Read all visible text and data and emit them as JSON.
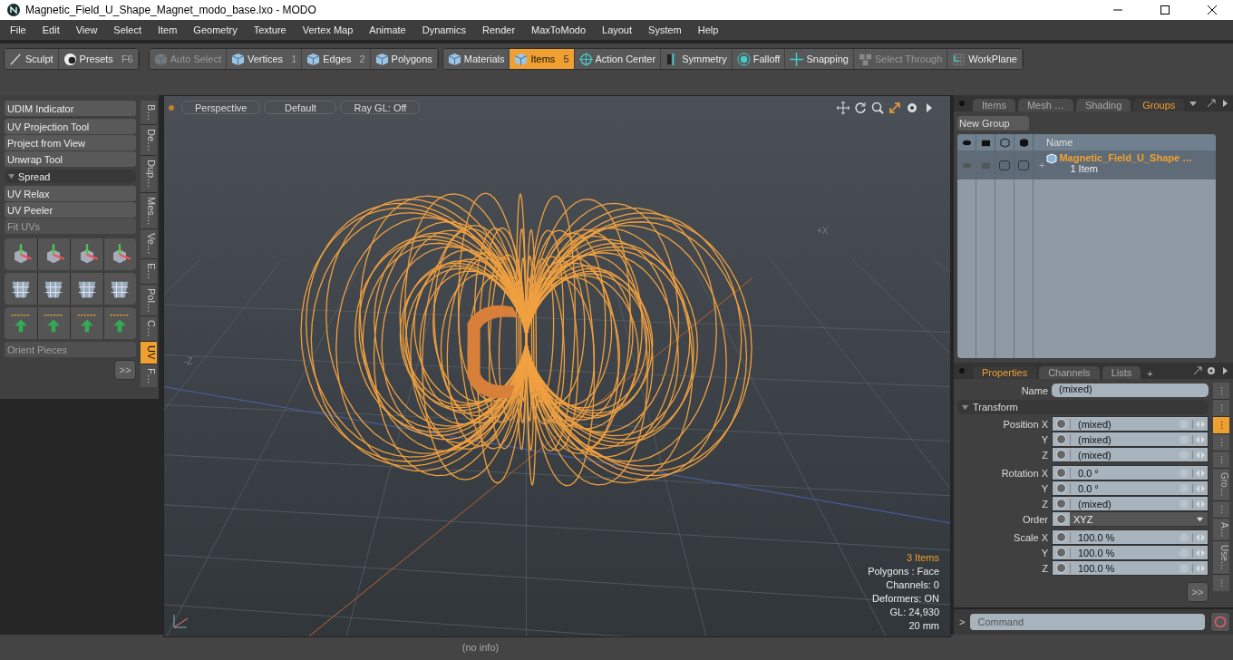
{
  "window": {
    "title": "Magnetic_Field_U_Shape_Magnet_modo_base.lxo - MODO"
  },
  "menu": [
    "File",
    "Edit",
    "View",
    "Select",
    "Item",
    "Geometry",
    "Texture",
    "Vertex Map",
    "Animate",
    "Dynamics",
    "Render",
    "MaxToModo",
    "Layout",
    "System",
    "Help"
  ],
  "toolbar": [
    [
      {
        "label": "Sculpt",
        "disabled": false,
        "selected": false
      },
      {
        "label": "Presets",
        "shortcut": "F6",
        "disabled": false,
        "selected": false
      }
    ],
    [
      {
        "label": "Auto Select",
        "disabled": true,
        "selected": false
      },
      {
        "label": "Vertices",
        "shortcut": "1",
        "disabled": false,
        "selected": false
      },
      {
        "label": "Edges",
        "shortcut": "2",
        "disabled": false,
        "selected": false
      },
      {
        "label": "Polygons",
        "disabled": false,
        "selected": false
      }
    ],
    [
      {
        "label": "Materials",
        "disabled": false,
        "selected": false
      },
      {
        "label": "Items",
        "shortcut": "5",
        "disabled": false,
        "selected": true
      },
      {
        "label": "Action Center",
        "disabled": false,
        "selected": false
      },
      {
        "label": "Symmetry",
        "disabled": false,
        "selected": false
      },
      {
        "label": "Falloff",
        "disabled": false,
        "selected": false
      },
      {
        "label": "Snapping",
        "disabled": false,
        "selected": false
      },
      {
        "label": "Select Through",
        "disabled": true,
        "selected": false
      },
      {
        "label": "WorkPlane",
        "disabled": false,
        "selected": false
      }
    ]
  ],
  "left_panel": {
    "tool_groups": [
      {
        "kind": "buttons",
        "items": [
          {
            "label": "UDIM Indicator",
            "disabled": false
          }
        ]
      },
      {
        "kind": "buttons",
        "items": [
          {
            "label": "UV Projection Tool",
            "disabled": false
          },
          {
            "label": "Project from View",
            "disabled": false
          },
          {
            "label": "Unwrap Tool",
            "disabled": false
          }
        ]
      },
      {
        "kind": "section",
        "label": "Spread",
        "expanded": true
      },
      {
        "kind": "buttons",
        "items": [
          {
            "label": "UV Relax",
            "disabled": false
          },
          {
            "label": "UV Peeler",
            "disabled": false
          },
          {
            "label": "Fit UVs",
            "disabled": true
          }
        ]
      },
      {
        "kind": "icons"
      },
      {
        "kind": "buttons",
        "items": [
          {
            "label": "Orient Pieces",
            "disabled": true
          }
        ]
      }
    ],
    "more": ">>",
    "tabs": [
      {
        "label": "B…",
        "selected": false
      },
      {
        "label": "De…",
        "selected": false
      },
      {
        "label": "Dup…",
        "selected": false
      },
      {
        "label": "Mes…",
        "selected": false
      },
      {
        "label": "Ve…",
        "selected": false
      },
      {
        "label": "E…",
        "selected": false
      },
      {
        "label": "Pol…",
        "selected": false
      },
      {
        "label": "C…",
        "selected": false
      },
      {
        "label": "UV",
        "selected": true
      },
      {
        "label": "F…",
        "selected": false
      }
    ]
  },
  "viewport": {
    "buttons": [
      "Perspective",
      "Default",
      "Ray GL: Off"
    ],
    "axis_labels": [
      "+X",
      "-Z"
    ],
    "info": [
      {
        "text": "3 Items",
        "highlight": true
      },
      {
        "text": "Polygons : Face",
        "highlight": false
      },
      {
        "text": "Channels: 0",
        "highlight": false
      },
      {
        "text": "Deformers: ON",
        "highlight": false
      },
      {
        "text": "GL: 24,930",
        "highlight": false
      },
      {
        "text": "20 mm",
        "highlight": false
      }
    ]
  },
  "status_bar": "(no info)",
  "groups_panel": {
    "tabs": [
      {
        "label": "Items",
        "selected": false
      },
      {
        "label": "Mesh …",
        "selected": false
      },
      {
        "label": "Shading",
        "selected": false
      },
      {
        "label": "Groups",
        "selected": true
      }
    ],
    "new_group": "New Group",
    "name_column": "Name",
    "rows": [
      {
        "name": "Magnetic_Field_U_Shape …",
        "count": "1 Item",
        "expand": "+",
        "toggles": [
          false,
          false
        ]
      }
    ]
  },
  "properties_panel": {
    "tabs": [
      {
        "label": "Properties",
        "selected": true
      },
      {
        "label": "Channels",
        "selected": false
      },
      {
        "label": "Lists",
        "selected": false
      }
    ],
    "add_tab": "+",
    "name_label": "Name",
    "name_value": "(mixed)",
    "section": {
      "label": "Transform",
      "expanded": true
    },
    "groups": [
      [
        {
          "label": "Position X",
          "value": "(mixed)",
          "kind": "field",
          "animated": false
        },
        {
          "label": "Y",
          "value": "(mixed)",
          "kind": "field",
          "animated": false
        },
        {
          "label": "Z",
          "value": "(mixed)",
          "kind": "field",
          "animated": false
        }
      ],
      [
        {
          "label": "Rotation X",
          "value": "0.0 °",
          "kind": "field",
          "animated": false
        },
        {
          "label": "Y",
          "value": "0.0 °",
          "kind": "field",
          "animated": false
        },
        {
          "label": "Z",
          "value": "(mixed)",
          "kind": "field",
          "animated": false
        },
        {
          "label": "Order",
          "value": "XYZ",
          "kind": "dropdown",
          "animated": false
        }
      ],
      [
        {
          "label": "Scale X",
          "value": "100.0 %",
          "kind": "field",
          "animated": false
        },
        {
          "label": "Y",
          "value": "100.0 %",
          "kind": "field",
          "animated": false
        },
        {
          "label": "Z",
          "value": "100.0 %",
          "kind": "field",
          "animated": false
        }
      ]
    ],
    "more": ">>",
    "side_tabs": [
      {
        "label": "…",
        "selected": false
      },
      {
        "label": "…",
        "selected": false
      },
      {
        "label": "…",
        "selected": true
      },
      {
        "label": "…",
        "selected": false
      },
      {
        "label": "…",
        "selected": false
      },
      {
        "label": "Gro…",
        "selected": false
      },
      {
        "label": "…",
        "selected": false
      },
      {
        "label": "A…",
        "selected": false
      },
      {
        "label": "Use…",
        "selected": false
      },
      {
        "label": "…",
        "selected": false
      }
    ]
  },
  "command": {
    "prompt": ">",
    "placeholder": "Command"
  }
}
